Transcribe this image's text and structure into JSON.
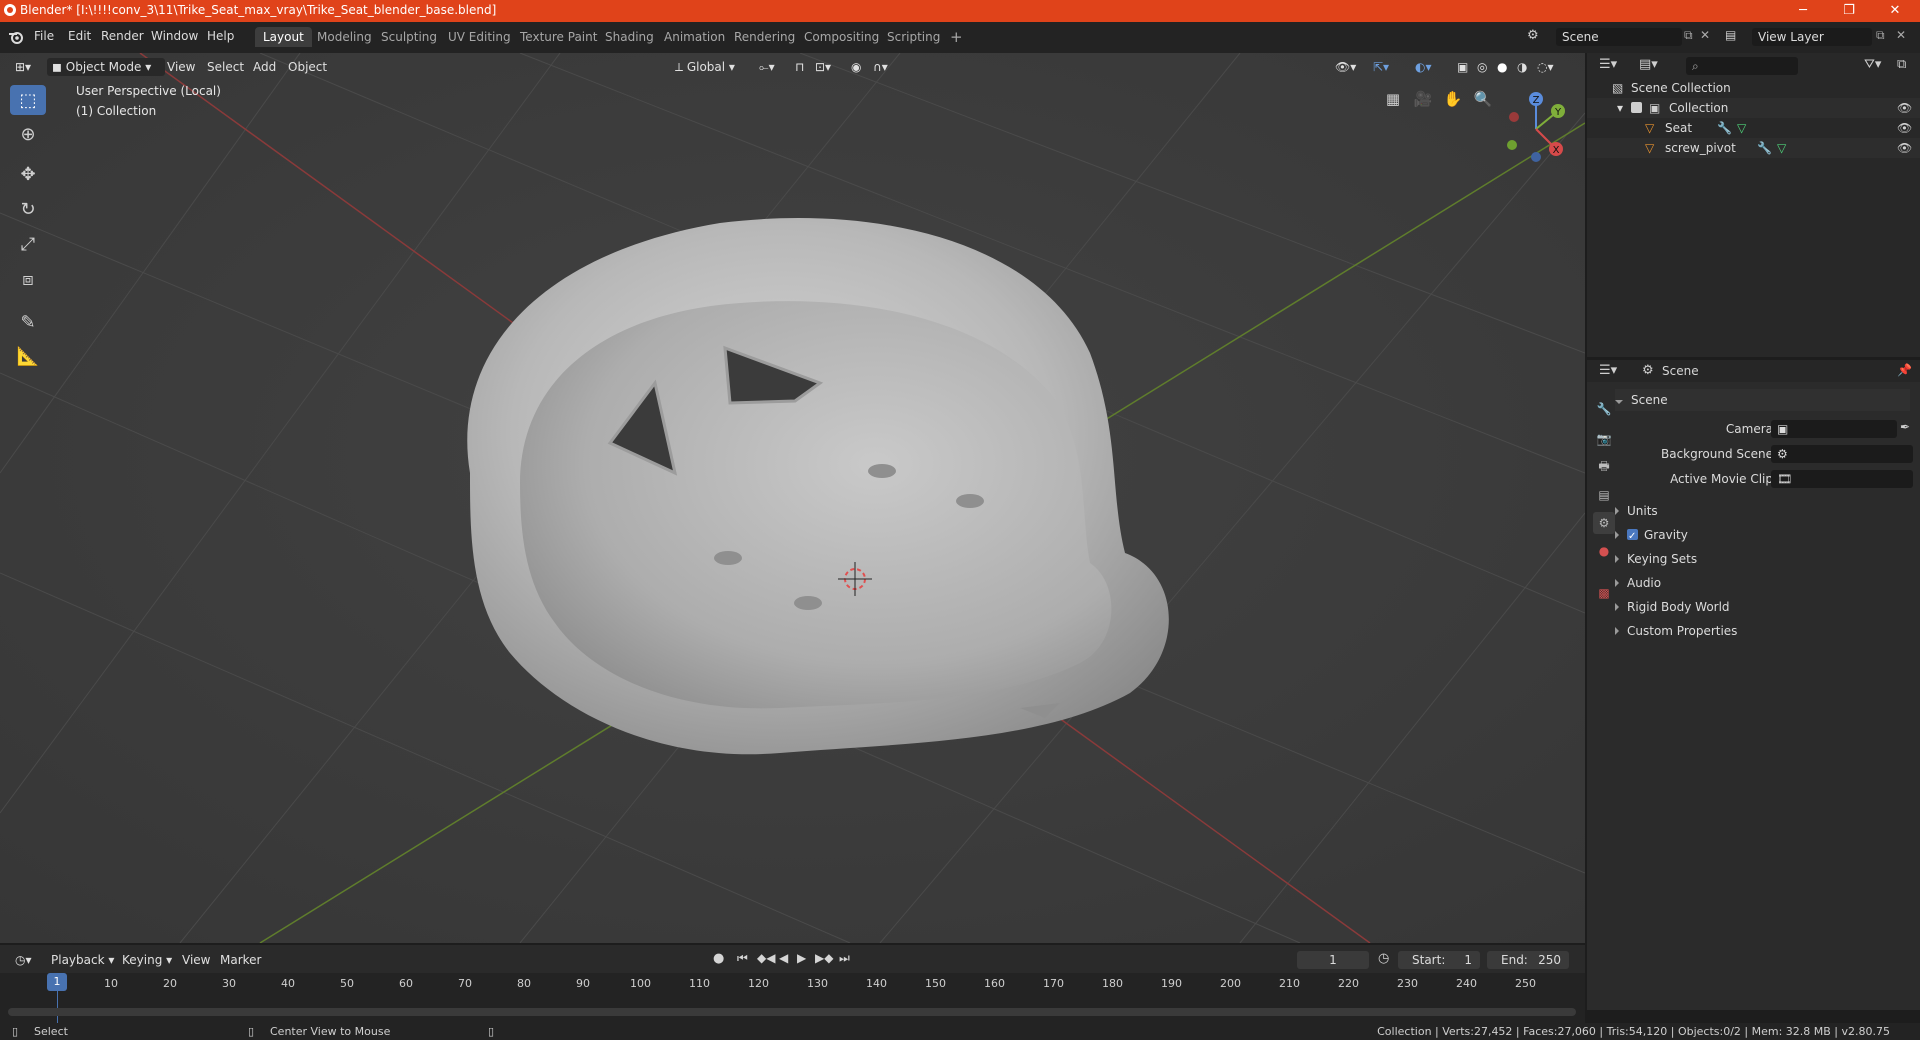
{
  "window": {
    "title": "Blender* [I:\\!!!!conv_3\\11\\Trike_Seat_max_vray\\Trike_Seat_blender_base.blend]",
    "minimize": "─",
    "maximize": "❐",
    "close": "✕"
  },
  "menu": {
    "items": [
      "File",
      "Edit",
      "Render",
      "Window",
      "Help"
    ]
  },
  "workspaces": {
    "tabs": [
      "Layout",
      "Modeling",
      "Sculpting",
      "UV Editing",
      "Texture Paint",
      "Shading",
      "Animation",
      "Rendering",
      "Compositing",
      "Scripting"
    ],
    "active_index": 0,
    "add": "+"
  },
  "scene_selector": {
    "value": "Scene"
  },
  "view_layer_selector": {
    "value": "View Layer"
  },
  "viewport_header": {
    "mode": "Object Mode",
    "menus": [
      "View",
      "Select",
      "Add",
      "Object"
    ],
    "orientation": "Global"
  },
  "viewport": {
    "perspective_label": "User Perspective (Local)",
    "collection_label": "(1) Collection",
    "gizmo": {
      "z": "Z",
      "y": "Y",
      "x": "X"
    }
  },
  "outliner": {
    "search_placeholder": "",
    "root": "Scene Collection",
    "collection": "Collection",
    "objects": [
      {
        "name": "Seat"
      },
      {
        "name": "screw_pivot"
      }
    ]
  },
  "properties": {
    "context": "Scene",
    "panel_title": "Scene",
    "camera_label": "Camera",
    "camera_value": "",
    "background_scene_label": "Background Scene",
    "background_scene_value": "",
    "active_movie_clip_label": "Active Movie Clip",
    "active_movie_clip_value": "",
    "collapsed_panels": [
      "Units",
      "Gravity",
      "Keying Sets",
      "Audio",
      "Rigid Body World",
      "Custom Properties"
    ],
    "gravity_enabled": true
  },
  "timeline": {
    "menus": [
      "Playback",
      "Keying",
      "View",
      "Marker"
    ],
    "current_frame": "1",
    "start_label": "Start:",
    "start_value": "1",
    "end_label": "End:",
    "end_value": "250",
    "ticks": [
      "10",
      "20",
      "30",
      "40",
      "50",
      "60",
      "70",
      "80",
      "90",
      "100",
      "110",
      "120",
      "130",
      "140",
      "150",
      "160",
      "170",
      "180",
      "190",
      "200",
      "210",
      "220",
      "230",
      "240",
      "250"
    ],
    "playhead_label": "1"
  },
  "statusbar": {
    "left_action": "Select",
    "middle_action": "Center View to Mouse",
    "stats": "Collection | Verts:27,452 | Faces:27,060 | Tris:54,120 | Objects:0/2 | Mem: 32.8 MB | v2.80.75"
  },
  "colors": {
    "accent": "#4872b0",
    "titlebar": "#e0431a",
    "viewport_bg": "#3d3d3d",
    "object_orange": "#e8922f",
    "modifier_blue": "#6ea0e0",
    "mesh_green": "#4fd37a"
  }
}
